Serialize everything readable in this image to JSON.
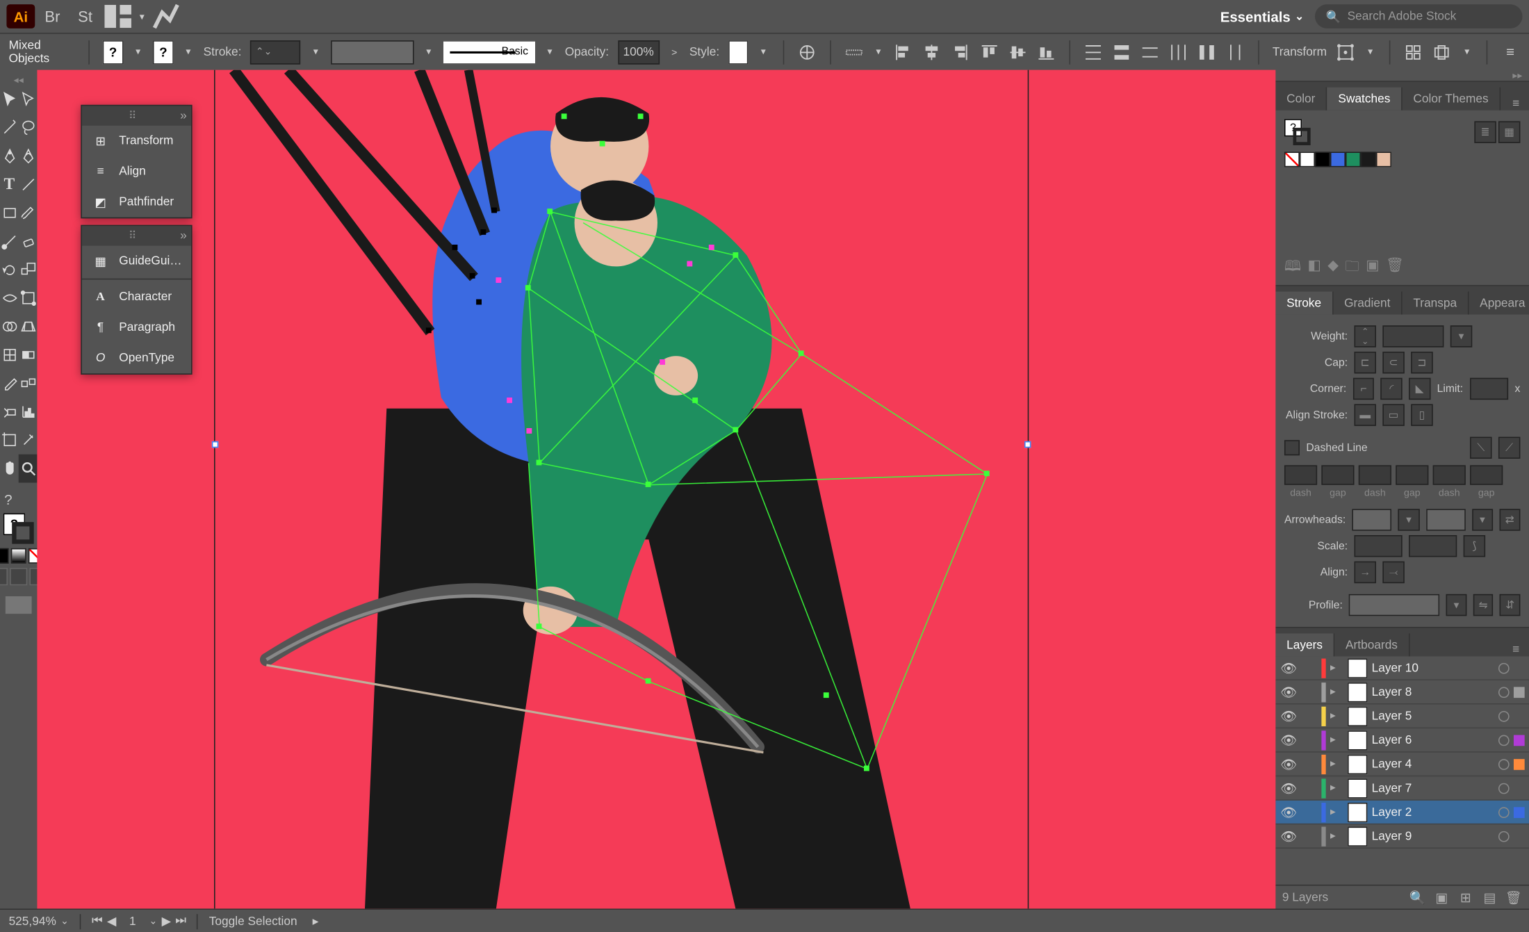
{
  "menubar": {
    "workspace": "Essentials",
    "search_placeholder": "Search Adobe Stock",
    "bridge": "Br",
    "stock": "St"
  },
  "controlbar": {
    "selection": "Mixed Objects",
    "fill_mark": "?",
    "stroke_mark": "?",
    "stroke_label": "Stroke:",
    "stroke_value": "",
    "brush_label": "Basic",
    "opacity_label": "Opacity:",
    "opacity_value": "100%",
    "style_label": "Style:",
    "transform_label": "Transform"
  },
  "float1": {
    "items": [
      "Transform",
      "Align",
      "Pathfinder"
    ]
  },
  "float2": {
    "items": [
      "GuideGui…",
      "Character",
      "Paragraph",
      "OpenType"
    ]
  },
  "swatches": {
    "tabs": [
      "Color",
      "Swatches",
      "Color Themes"
    ],
    "colors": [
      "none",
      "#ffffff",
      "#000000",
      "#3b6ae1",
      "#1e8f5f",
      "#1a1a1a",
      "#e7bfa5"
    ]
  },
  "stroke_panel": {
    "tabs": [
      "Stroke",
      "Gradient",
      "Transpa",
      "Appeara"
    ],
    "weight": "Weight:",
    "cap": "Cap:",
    "corner": "Corner:",
    "limit": "Limit:",
    "align_stroke": "Align Stroke:",
    "dashed": "Dashed Line",
    "dash_labels": [
      "dash",
      "gap",
      "dash",
      "gap",
      "dash",
      "gap"
    ],
    "arrowheads": "Arrowheads:",
    "scale": "Scale:",
    "align": "Align:",
    "profile": "Profile:"
  },
  "layers_panel": {
    "tabs": [
      "Layers",
      "Artboards"
    ],
    "layers": [
      {
        "name": "Layer 10",
        "color": "#ff3b3b",
        "selected": false,
        "mark": ""
      },
      {
        "name": "Layer 8",
        "color": "#9e9e9e",
        "selected": false,
        "mark": "sq"
      },
      {
        "name": "Layer 5",
        "color": "#f5d14a",
        "selected": false,
        "mark": ""
      },
      {
        "name": "Layer 6",
        "color": "#b03bd6",
        "selected": false,
        "mark": "sqc"
      },
      {
        "name": "Layer 4",
        "color": "#ff8a3b",
        "selected": false,
        "mark": "sqc"
      },
      {
        "name": "Layer 7",
        "color": "#2bb36b",
        "selected": false,
        "mark": ""
      },
      {
        "name": "Layer 2",
        "color": "#3b6ae1",
        "selected": true,
        "mark": "sqc"
      },
      {
        "name": "Layer 9",
        "color": "#8a8a8a",
        "selected": false,
        "mark": ""
      }
    ],
    "count": "9 Layers"
  },
  "statusbar": {
    "zoom": "525,94%",
    "artboard_nav": "1",
    "tool": "Toggle Selection"
  },
  "colors": {
    "canvas_bg": "#f53b57"
  }
}
